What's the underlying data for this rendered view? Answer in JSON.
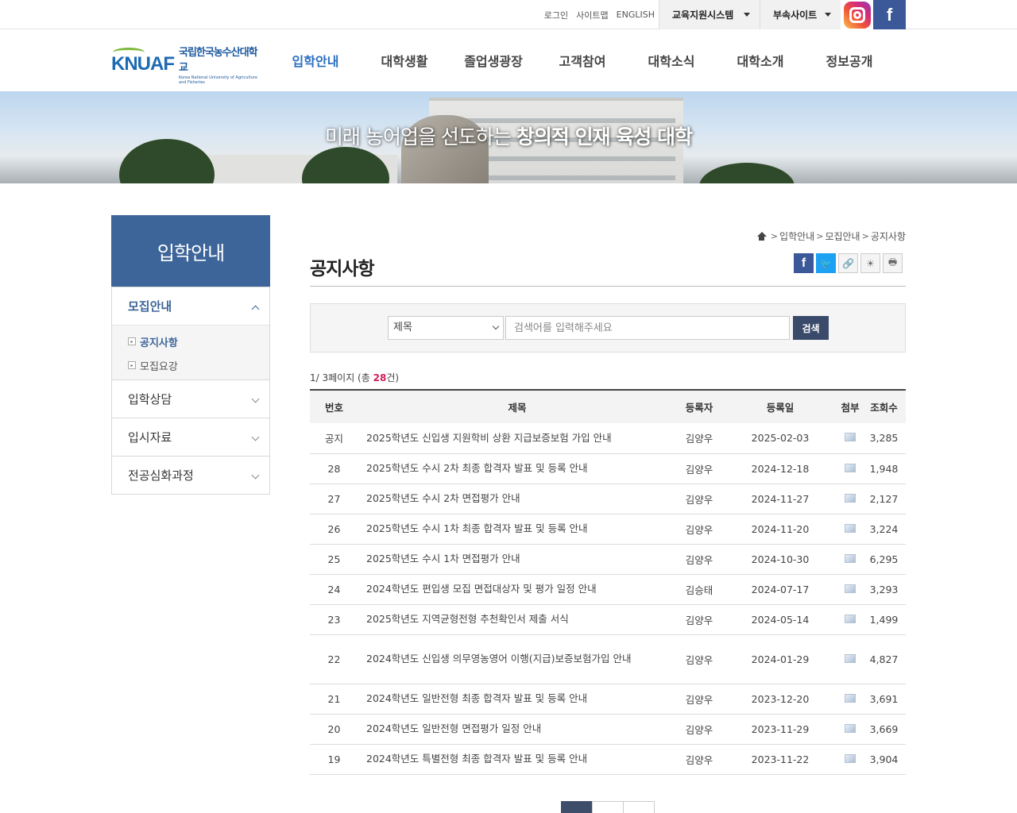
{
  "util": {
    "links": [
      "로그인",
      "사이트맵",
      "ENGLISH"
    ],
    "dropdown1": "교육지원시스템",
    "dropdown2": "부속사이트",
    "instagram_icon": "instagram-icon",
    "facebook_icon": "facebook-icon",
    "facebook_glyph": "f"
  },
  "logo": {
    "mark": "KNUAF",
    "name_ko": "국립한국농수산대학교",
    "name_en": "Korea National University of Agriculture and Fisheries"
  },
  "gnb": [
    "입학안내",
    "대학생활",
    "졸업생광장",
    "고객참여",
    "대학소식",
    "대학소개",
    "정보공개"
  ],
  "visual": {
    "slogan_light": "미래 농어업을 선도하는 ",
    "slogan_bold": "창의적 인재 육성 대학"
  },
  "lnb": {
    "title": "입학안내",
    "menu1": "모집안내",
    "sub": [
      "공지사항",
      "모집요강"
    ],
    "menu2": "입학상담",
    "menu3": "입시자료",
    "menu4": "전공심화과정"
  },
  "breadcrumb": [
    "입학안내",
    "모집안내",
    "공지사항"
  ],
  "page_title": "공지사항",
  "share": {
    "facebook_glyph": "f",
    "twitter_glyph": "🐦",
    "link_glyph": "🔗",
    "share_glyph": "☀",
    "print_glyph": "🖶"
  },
  "search": {
    "select_value": "제목",
    "placeholder": "검색어를 입력해주세요",
    "button": "검색"
  },
  "page_info": {
    "prefix": "1/ 3페이지 (총 ",
    "count": "28",
    "suffix": "건)"
  },
  "table": {
    "headers": [
      "번호",
      "제목",
      "등록자",
      "등록일",
      "첨부",
      "조회수"
    ],
    "rows": [
      {
        "num": "공지",
        "title": "2025학년도 신입생 지원학비 상환 지급보증보험 가입 안내",
        "author": "김양우",
        "date": "2025-02-03",
        "views": "3,285"
      },
      {
        "num": "28",
        "title": "2025학년도 수시 2차 최종 합격자 발표 및 등록 안내",
        "author": "김양우",
        "date": "2024-12-18",
        "views": "1,948"
      },
      {
        "num": "27",
        "title": "2025학년도 수시 2차 면접평가 안내",
        "author": "김양우",
        "date": "2024-11-27",
        "views": "2,127"
      },
      {
        "num": "26",
        "title": "2025학년도 수시 1차 최종 합격자 발표 및 등록 안내",
        "author": "김양우",
        "date": "2024-11-20",
        "views": "3,224"
      },
      {
        "num": "25",
        "title": "2025학년도 수시 1차 면접평가 안내",
        "author": "김양우",
        "date": "2024-10-30",
        "views": "6,295"
      },
      {
        "num": "24",
        "title": "2024학년도 편입생 모집 면접대상자 및 평가 일정 안내",
        "author": "김승태",
        "date": "2024-07-17",
        "views": "3,293"
      },
      {
        "num": "23",
        "title": "2025학년도 지역균형전형 추천확인서 제출 서식",
        "author": "김양우",
        "date": "2024-05-14",
        "views": "1,499"
      },
      {
        "num": "22",
        "title": "2024학년도 신입생 의무영농영어 이행(지급)보증보험가입 안내",
        "author": "김양우",
        "date": "2024-01-29",
        "views": "4,827"
      },
      {
        "num": "21",
        "title": "2024학년도 일반전형 최종 합격자 발표 및 등록 안내",
        "author": "김양우",
        "date": "2023-12-20",
        "views": "3,691"
      },
      {
        "num": "20",
        "title": "2024학년도 일반전형 면접평가 일정 안내",
        "author": "김양우",
        "date": "2023-11-29",
        "views": "3,669"
      },
      {
        "num": "19",
        "title": "2024학년도 특별전형 최종 합격자 발표 및 등록 안내",
        "author": "김양우",
        "date": "2023-11-22",
        "views": "3,904"
      }
    ],
    "attachment_icon": "image-attachment-icon"
  },
  "paging": [
    "",
    "",
    ""
  ]
}
